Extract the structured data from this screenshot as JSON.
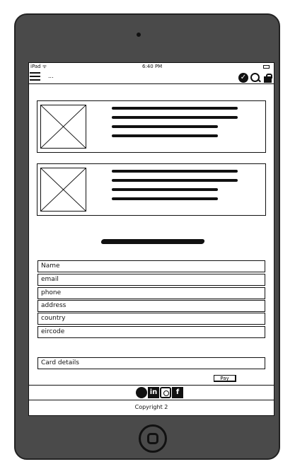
{
  "status_bar": {
    "carrier": "iPad ᯤ",
    "time": "6:40 PM"
  },
  "nav": {
    "label": "...",
    "icons": [
      "check-circle-icon",
      "search-icon",
      "shopping-bag-icon"
    ]
  },
  "products": [
    {
      "image": "placeholder-image"
    },
    {
      "image": "placeholder-image"
    }
  ],
  "form": {
    "fields": [
      "Name",
      "email",
      "phone",
      "address",
      "country",
      "eircode"
    ],
    "card_details": "Card details",
    "pay_label": "Pay"
  },
  "social": {
    "icons": [
      "github-icon",
      "linkedin-icon",
      "instagram-icon",
      "facebook-icon"
    ],
    "linkedin_text": "in",
    "facebook_text": "f"
  },
  "footer": {
    "copyright": "Copyright 2"
  },
  "colors": {
    "device": "#4a4a4a",
    "ink": "#111111",
    "screen": "#ffffff"
  }
}
